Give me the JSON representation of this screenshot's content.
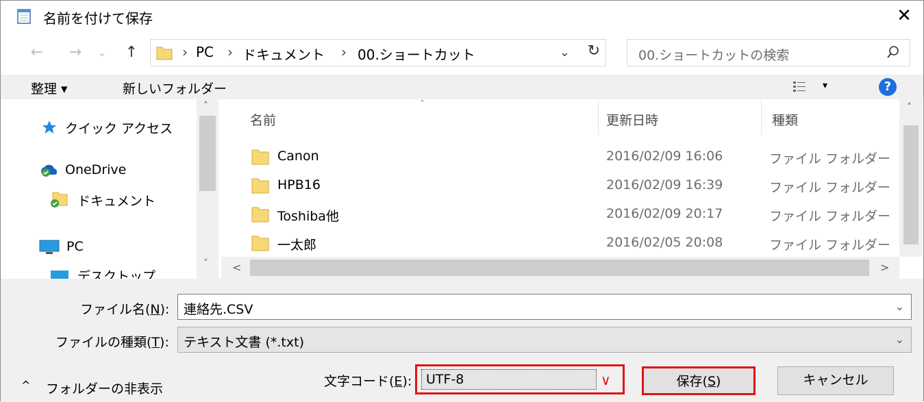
{
  "window": {
    "title": "名前を付けて保存",
    "close_glyph": "✕"
  },
  "nav": {
    "back": "←",
    "forward": "→",
    "recent": "⌄",
    "up": "↑",
    "address": {
      "breadcrumbs": [
        "PC",
        "ドキュメント",
        "00.ショートカット"
      ],
      "separator": "›",
      "dropdown": "⌄",
      "refresh": "↻"
    },
    "search_placeholder": "00.ショートカットの検索"
  },
  "toolbar": {
    "organize": "整理 ▾",
    "new_folder": "新しいフォルダー",
    "view_arrow": "▾",
    "help": "?"
  },
  "sidebar": {
    "items": [
      {
        "label": "クイック アクセス",
        "icon": "star-icon"
      },
      {
        "label": "OneDrive",
        "icon": "onedrive-icon"
      },
      {
        "label": "ドキュメント",
        "icon": "folder-sync-icon"
      },
      {
        "label": "PC",
        "icon": "pc-icon"
      },
      {
        "label": "デスクトップ",
        "icon": "desktop-icon"
      }
    ],
    "scroll_up": "˄",
    "scroll_down": "˅"
  },
  "files": {
    "columns": {
      "name": "名前",
      "modified": "更新日時",
      "type": "種類"
    },
    "sort_arrow": "˄",
    "rows": [
      {
        "name": "Canon",
        "modified": "2016/02/09 16:06",
        "type": "ファイル フォルダー"
      },
      {
        "name": "HPB16",
        "modified": "2016/02/09 16:39",
        "type": "ファイル フォルダー"
      },
      {
        "name": "Toshiba他",
        "modified": "2016/02/09 20:17",
        "type": "ファイル フォルダー"
      },
      {
        "name": "一太郎",
        "modified": "2016/02/05 20:08",
        "type": "ファイル フォルダー"
      }
    ],
    "hscroll_left": "<",
    "hscroll_right": ">",
    "vscroll_up": "˄"
  },
  "form": {
    "filename_label": "ファイル名(",
    "filename_key": "N",
    "filename_label_end": "):",
    "filename_value": "連絡先.CSV",
    "filetype_label": "ファイルの種類(",
    "filetype_key": "T",
    "filetype_label_end": "):",
    "filetype_value": "テキスト文書 (*.txt)",
    "encoding_label": "文字コード(",
    "encoding_key": "E",
    "encoding_label_end": "):",
    "encoding_value": "UTF-8",
    "dropdown": "⌄",
    "enc_dropdown": "∨",
    "hide_folders": "フォルダーの非表示",
    "hide_arrow": "^",
    "save_label": "保存(",
    "save_key": "S",
    "save_label_end": ")",
    "cancel_label": "キャンセル"
  },
  "colors": {
    "highlight": "#e01313",
    "help_blue": "#1e6fd9",
    "folder": "#f8d775"
  }
}
